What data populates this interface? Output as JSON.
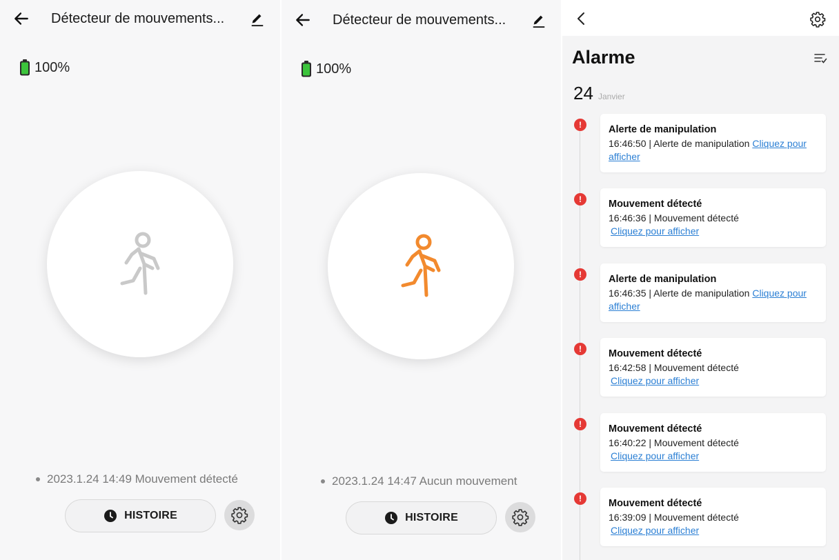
{
  "panels": [
    {
      "title": "Détecteur de mouvements...",
      "battery": "100%",
      "status": "2023.1.24 14:49 Mouvement détecté",
      "history_label": "HISTOIRE",
      "figure_color": "#c8c8c8"
    },
    {
      "title": "Détecteur de mouvements...",
      "battery": "100%",
      "status": "2023.1.24 14:47 Aucun mouvement",
      "history_label": "HISTOIRE",
      "figure_color": "#f28a2e"
    }
  ],
  "alarm": {
    "title": "Alarme",
    "date_day": "24",
    "date_month": "Janvier",
    "events": [
      {
        "title": "Alerte de manipulation",
        "detail": "16:46:50 | Alerte de manipulation",
        "link": "Cliquez pour afficher"
      },
      {
        "title": "Mouvement détecté",
        "detail": "16:46:36 | Mouvement détecté",
        "link": "Cliquez pour afficher"
      },
      {
        "title": "Alerte de manipulation",
        "detail": "16:46:35 | Alerte de manipulation",
        "link": "Cliquez pour afficher"
      },
      {
        "title": "Mouvement détecté",
        "detail": "16:42:58 | Mouvement détecté",
        "link": "Cliquez pour afficher"
      },
      {
        "title": "Mouvement détecté",
        "detail": "16:40:22 | Mouvement détecté",
        "link": "Cliquez pour afficher"
      },
      {
        "title": "Mouvement détecté",
        "detail": "16:39:09 | Mouvement détecté",
        "link": "Cliquez pour afficher"
      }
    ]
  },
  "colors": {
    "battery_green": "#3cc43c",
    "alert_red": "#e53935",
    "link_blue": "#2b7fd4"
  }
}
